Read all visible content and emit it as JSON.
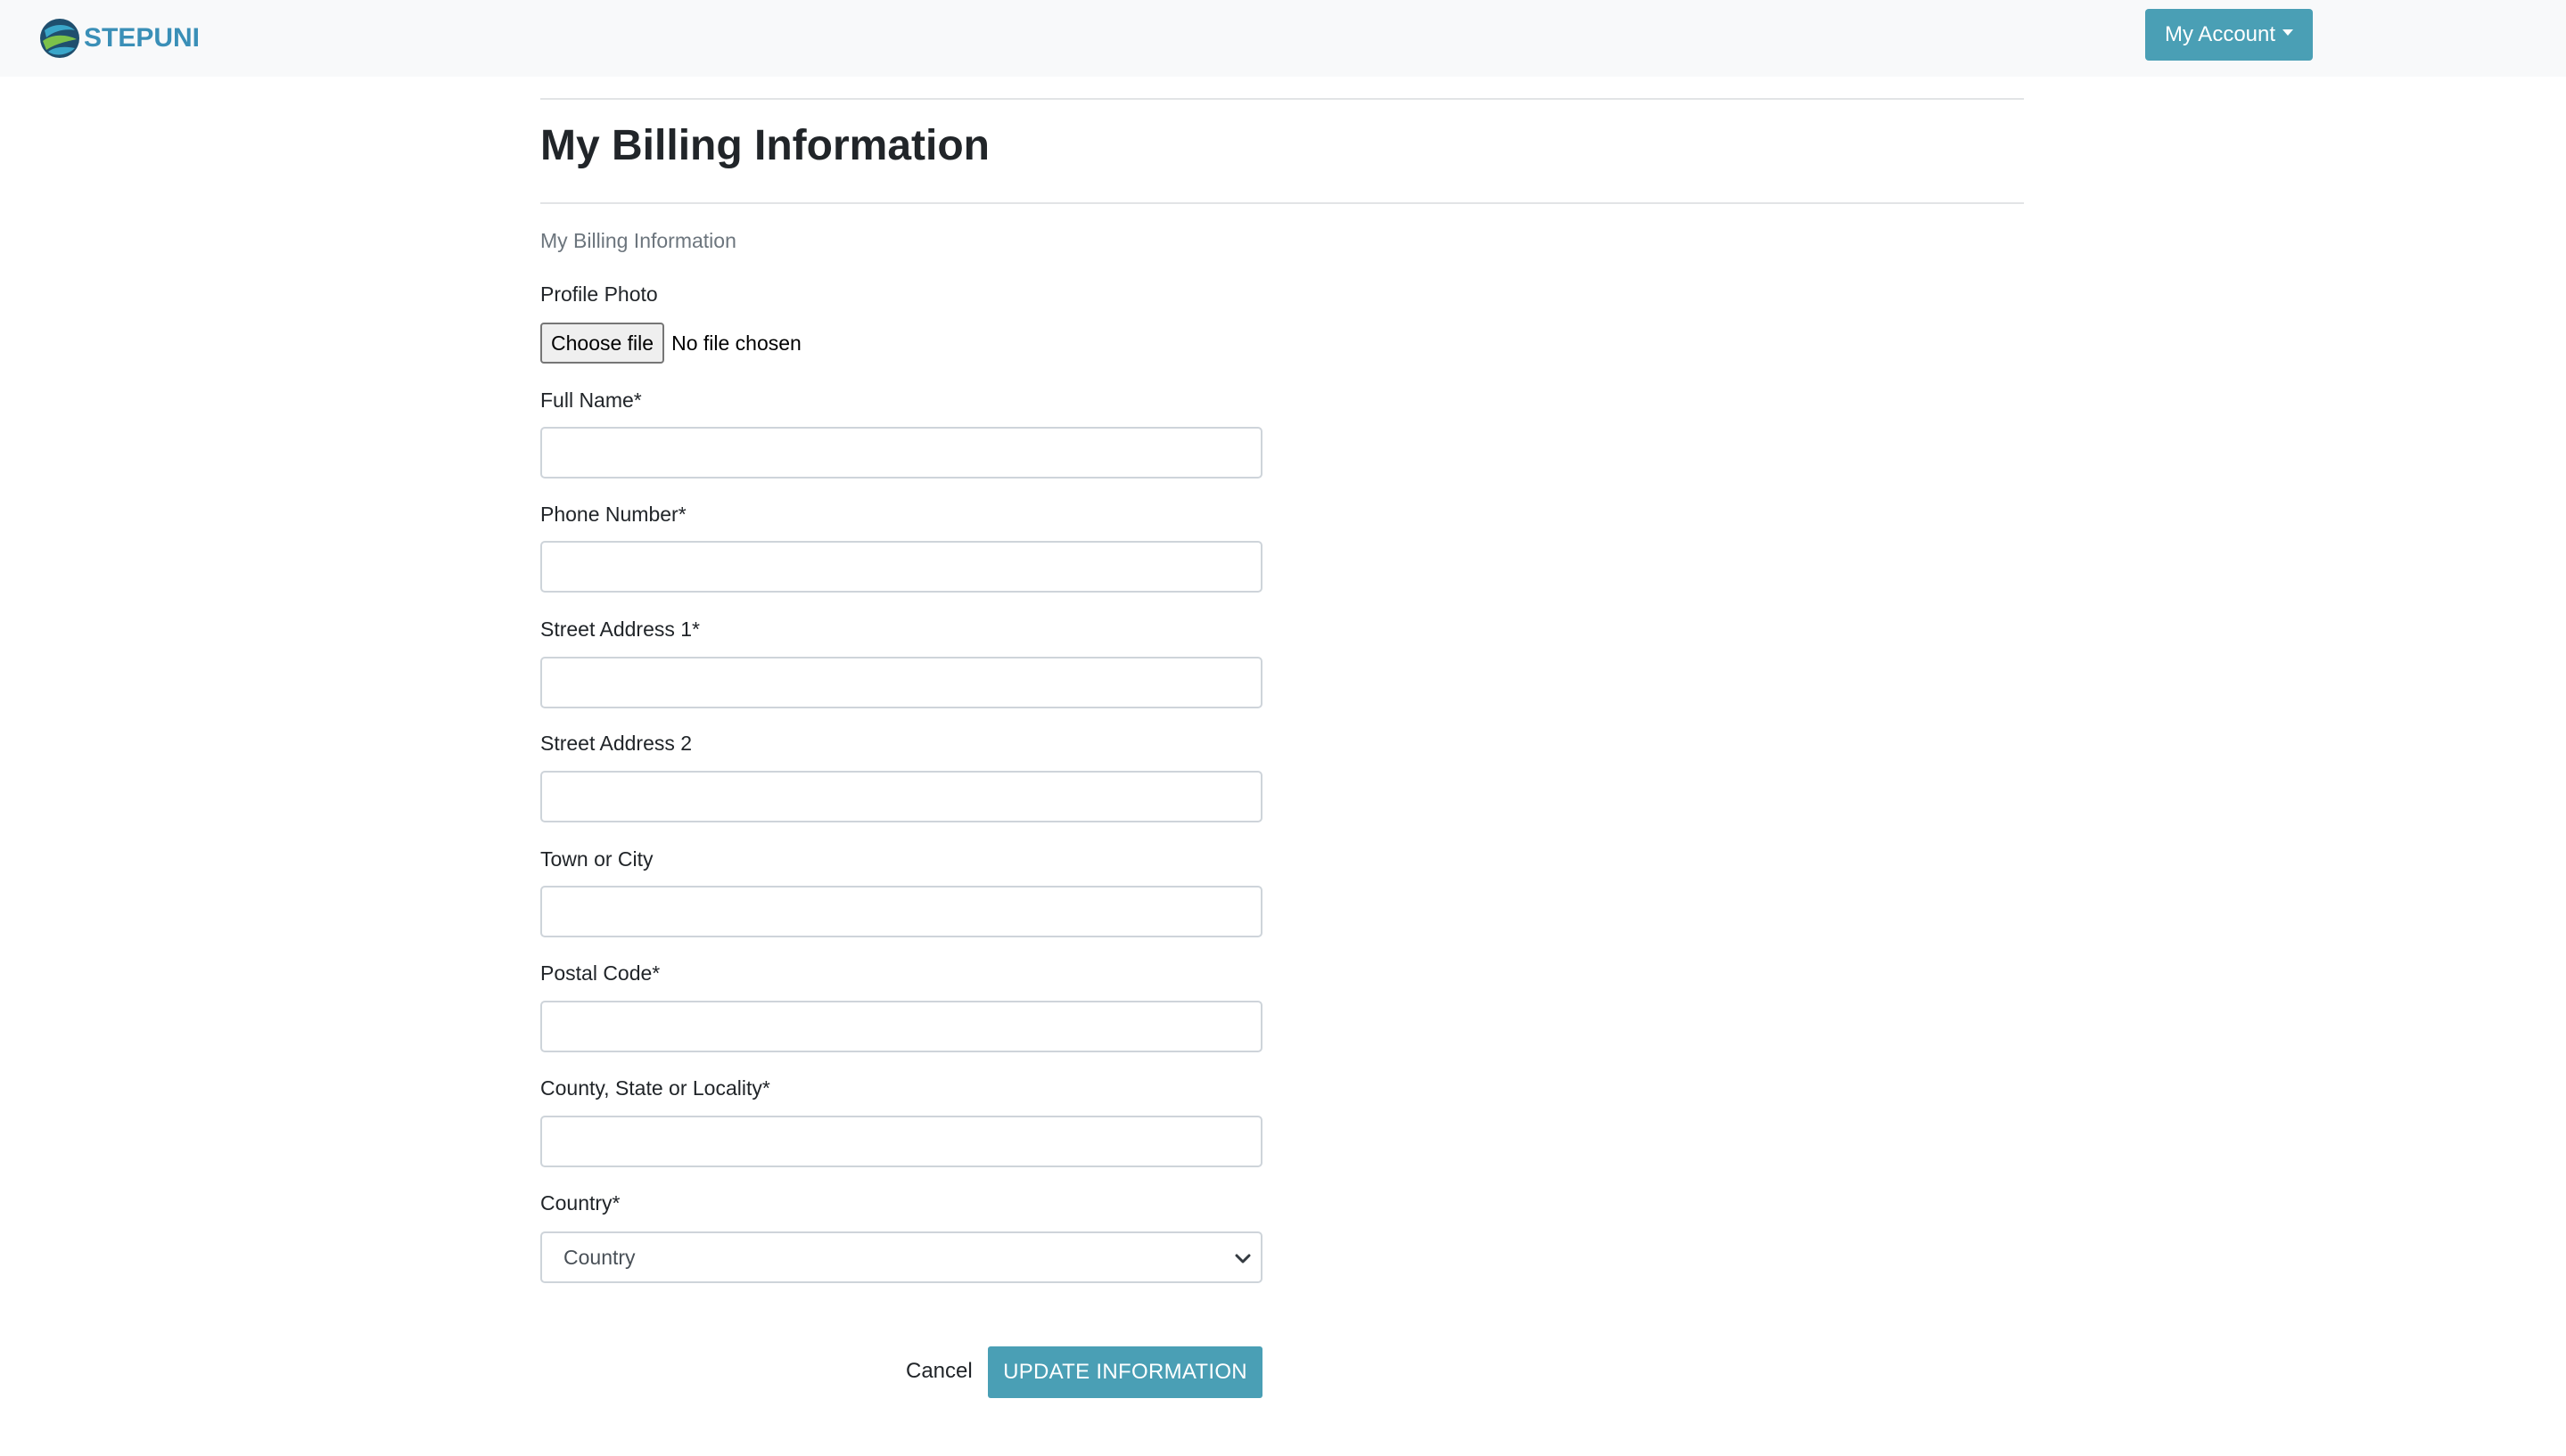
{
  "navbar": {
    "brand_text": "STEPUNI",
    "logo_icon": "globe-logo-icon",
    "account_label": "My Account",
    "accent_color": "#4a9fb5"
  },
  "page": {
    "title": "My Billing Information",
    "subtitle": "My Billing Information"
  },
  "form": {
    "profile_photo_label": "Profile Photo",
    "choose_file_label": "Choose file",
    "file_status": "No file chosen",
    "full_name_label": "Full Name*",
    "full_name_value": "",
    "phone_label": "Phone Number*",
    "phone_value": "",
    "street1_label": "Street Address 1*",
    "street1_value": "",
    "street2_label": "Street Address 2",
    "street2_value": "",
    "town_label": "Town or City",
    "town_value": "",
    "postal_label": "Postal Code*",
    "postal_value": "",
    "county_label": "County, State or Locality*",
    "county_value": "",
    "country_label": "Country*",
    "country_selected": "Country"
  },
  "actions": {
    "cancel_label": "Cancel",
    "update_label": "UPDATE INFORMATION"
  }
}
